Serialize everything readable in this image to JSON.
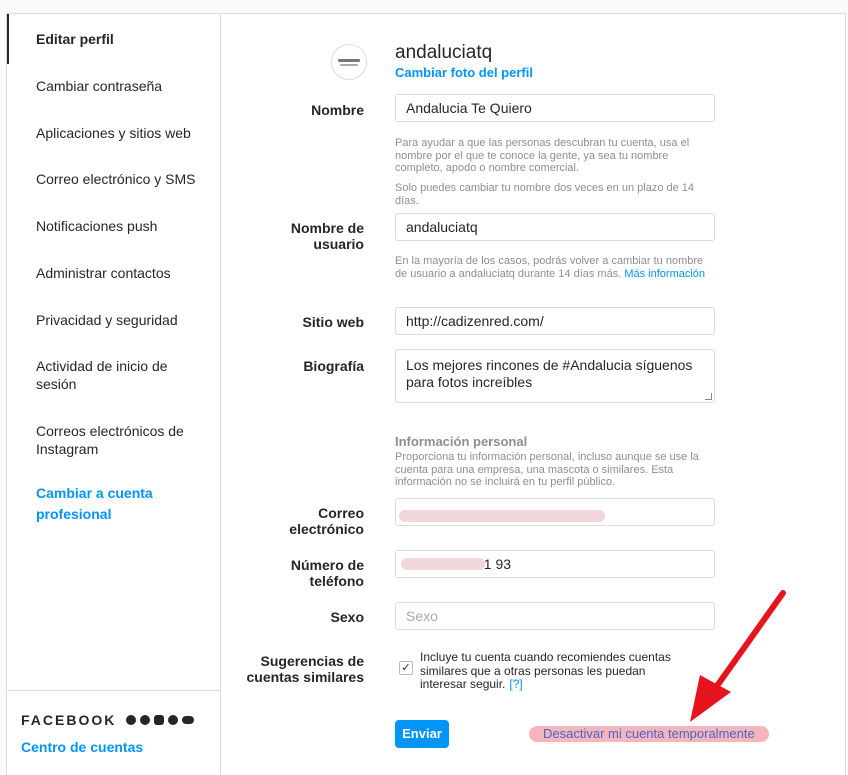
{
  "sidebar": {
    "items": [
      {
        "label": "Editar perfil"
      },
      {
        "label": "Cambiar contraseña"
      },
      {
        "label": "Aplicaciones y sitios web"
      },
      {
        "label": "Correo electrónico y SMS"
      },
      {
        "label": "Notificaciones push"
      },
      {
        "label": "Administrar contactos"
      },
      {
        "label": "Privacidad y seguridad"
      },
      {
        "label": "Actividad de inicio de sesión"
      },
      {
        "label": "Correos electrónicos de Instagram"
      },
      {
        "label": "Cambiar a cuenta profesional"
      }
    ],
    "facebook_label": "FACEBOOK",
    "accounts_center": "Centro de cuentas"
  },
  "profile": {
    "username": "andaluciatq",
    "change_photo": "Cambiar foto del perfil"
  },
  "form": {
    "name_label": "Nombre",
    "name_value": "Andalucia Te Quiero",
    "name_help_1": "Para ayudar a que las personas descubran tu cuenta, usa el nombre por el que te conoce la gente, ya sea tu nombre completo, apodo o nombre comercial.",
    "name_help_2": "Solo puedes cambiar tu nombre dos veces en un plazo de 14 días.",
    "username_label": "Nombre de usuario",
    "username_value": "andaluciatq",
    "username_help": "En la mayoría de los casos, podrás volver a cambiar tu nombre de usuario a andaluciatq durante 14 días más.",
    "username_help_link": "Más información",
    "website_label": "Sitio web",
    "website_value": "http://cadizenred.com/",
    "bio_label": "Biografía",
    "bio_value": "Los mejores rincones de #Andalucia síguenos para fotos increíbles",
    "personal_title": "Información personal",
    "personal_help": "Proporciona tu información personal, incluso aunque se use la cuenta para una empresa, una mascota o similares. Esta información no se incluirá en tu perfil público.",
    "email_label": "Correo electrónico",
    "email_value": "",
    "phone_label": "Número de teléfono",
    "phone_value": "61 93",
    "gender_label": "Sexo",
    "gender_placeholder": "Sexo",
    "suggest_label": "Sugerencias de cuentas similares",
    "suggest_text": "Incluye tu cuenta cuando recomiendes cuentas similares que a otras personas les puedan interesar seguir.",
    "suggest_help_link": "[?]",
    "suggest_checked": true,
    "submit_label": "Enviar",
    "deactivate_label": "Desactivar mi cuenta temporalmente"
  },
  "colors": {
    "accent": "#0095f6",
    "annotation_arrow": "#e8141d",
    "redaction": "#f1d7dc"
  }
}
